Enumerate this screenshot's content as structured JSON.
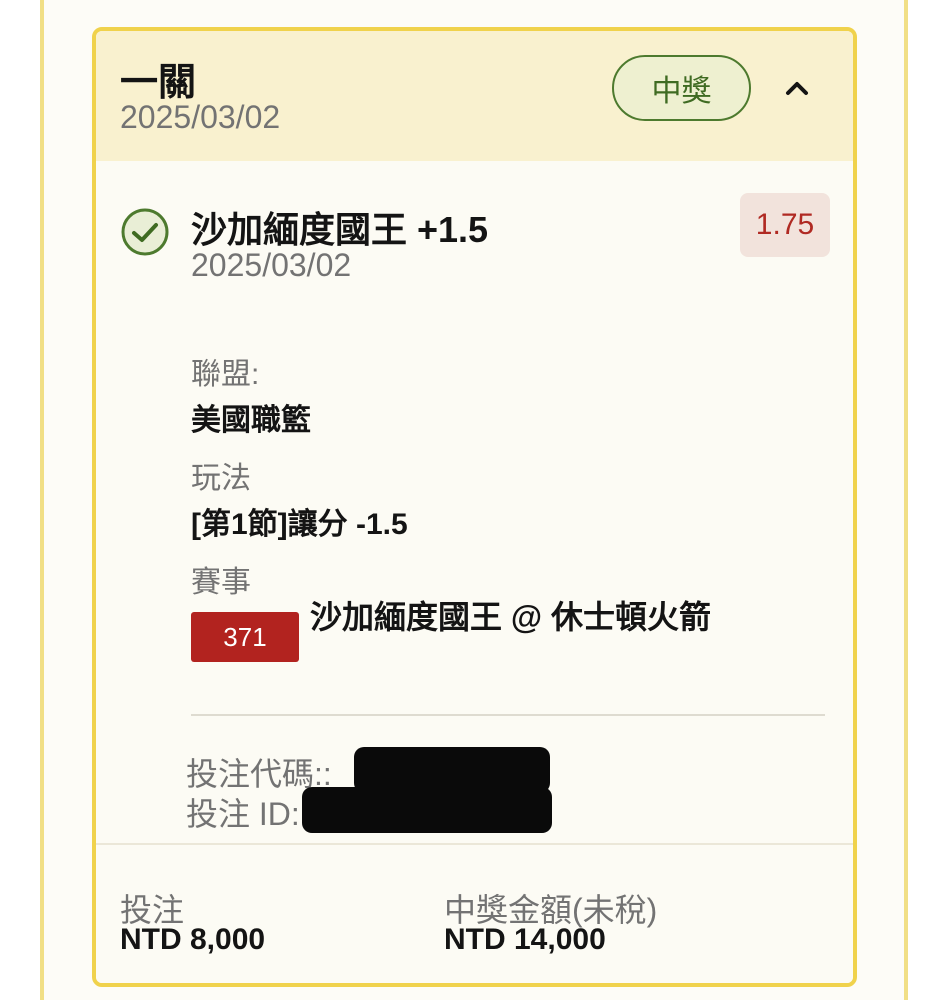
{
  "ticket": {
    "type_label": "一關",
    "date": "2025/03/02",
    "status_label": "中獎"
  },
  "selection": {
    "name": "沙加緬度國王 +1.5",
    "date": "2025/03/02",
    "odds": "1.75",
    "status_icon": "check-circle-icon"
  },
  "details": {
    "league_label": "聯盟:",
    "league_value": "美國職籃",
    "market_label": "玩法",
    "market_value": "[第1節]讓分 -1.5",
    "event_label": "賽事",
    "event_number": "371",
    "event_name": "沙加緬度國王 @ 休士頓火箭"
  },
  "meta": {
    "bet_code_label": "投注代碼::",
    "bet_id_label": "投注 ID:"
  },
  "footer": {
    "stake_label": "投注",
    "stake_value": "NTD 8,000",
    "payout_label": "中獎金額(未稅)",
    "payout_value": "NTD 14,000"
  },
  "colors": {
    "header_bg": "#f9f1cf",
    "card_border": "#f0d24c",
    "win_green": "#3f6b22",
    "odds_red": "#b02a23",
    "event_badge_red": "#b2231f"
  }
}
